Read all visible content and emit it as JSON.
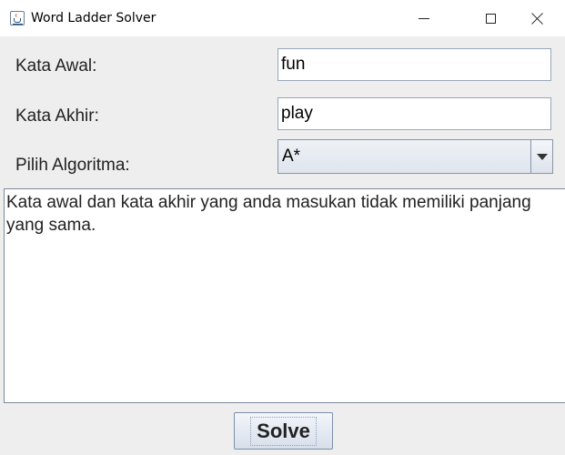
{
  "window": {
    "title": "Word Ladder Solver",
    "icon": "java-cup-icon"
  },
  "form": {
    "start_label": "Kata Awal:",
    "start_value": "fun",
    "end_label": "Kata Akhir:",
    "end_value": "play",
    "algo_label": "Pilih Algoritma:",
    "algo_selected": "A*"
  },
  "output": {
    "text": "Kata awal dan kata akhir yang anda masukan tidak memiliki panjang yang sama."
  },
  "actions": {
    "solve_label": "Solve"
  }
}
